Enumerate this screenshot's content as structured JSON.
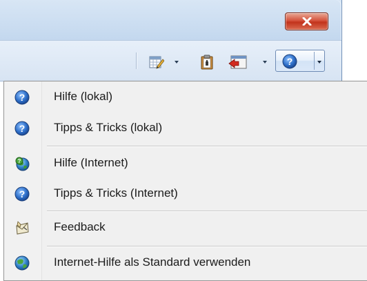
{
  "window": {
    "close_icon": "close-icon"
  },
  "toolbar": {
    "buttons": [
      {
        "icon": "edit-table-icon",
        "has_dropdown": true
      },
      {
        "icon": "clipboard-icon",
        "has_dropdown": false
      },
      {
        "icon": "window-arrow-icon",
        "has_dropdown": true
      },
      {
        "icon": "help-icon",
        "has_dropdown": true,
        "pressed": true
      }
    ]
  },
  "menu": {
    "items": [
      {
        "label": "Hilfe (lokal)",
        "icon": "help-icon"
      },
      {
        "label": "Tipps & Tricks (lokal)",
        "icon": "help-icon"
      },
      {
        "label": "Hilfe (Internet)",
        "icon": "globe-help-icon"
      },
      {
        "label": "Tipps & Tricks (Internet)",
        "icon": "help-icon"
      },
      {
        "label": "Feedback",
        "icon": "feedback-envelope-icon"
      },
      {
        "label": "Internet-Hilfe als Standard verwenden",
        "icon": "globe-icon"
      }
    ]
  },
  "colors": {
    "help_blue": "#2e6fc9",
    "close_red": "#c2331c",
    "menu_bg": "#f0f0f0",
    "toolbar_bg": "#d7e4f3"
  }
}
